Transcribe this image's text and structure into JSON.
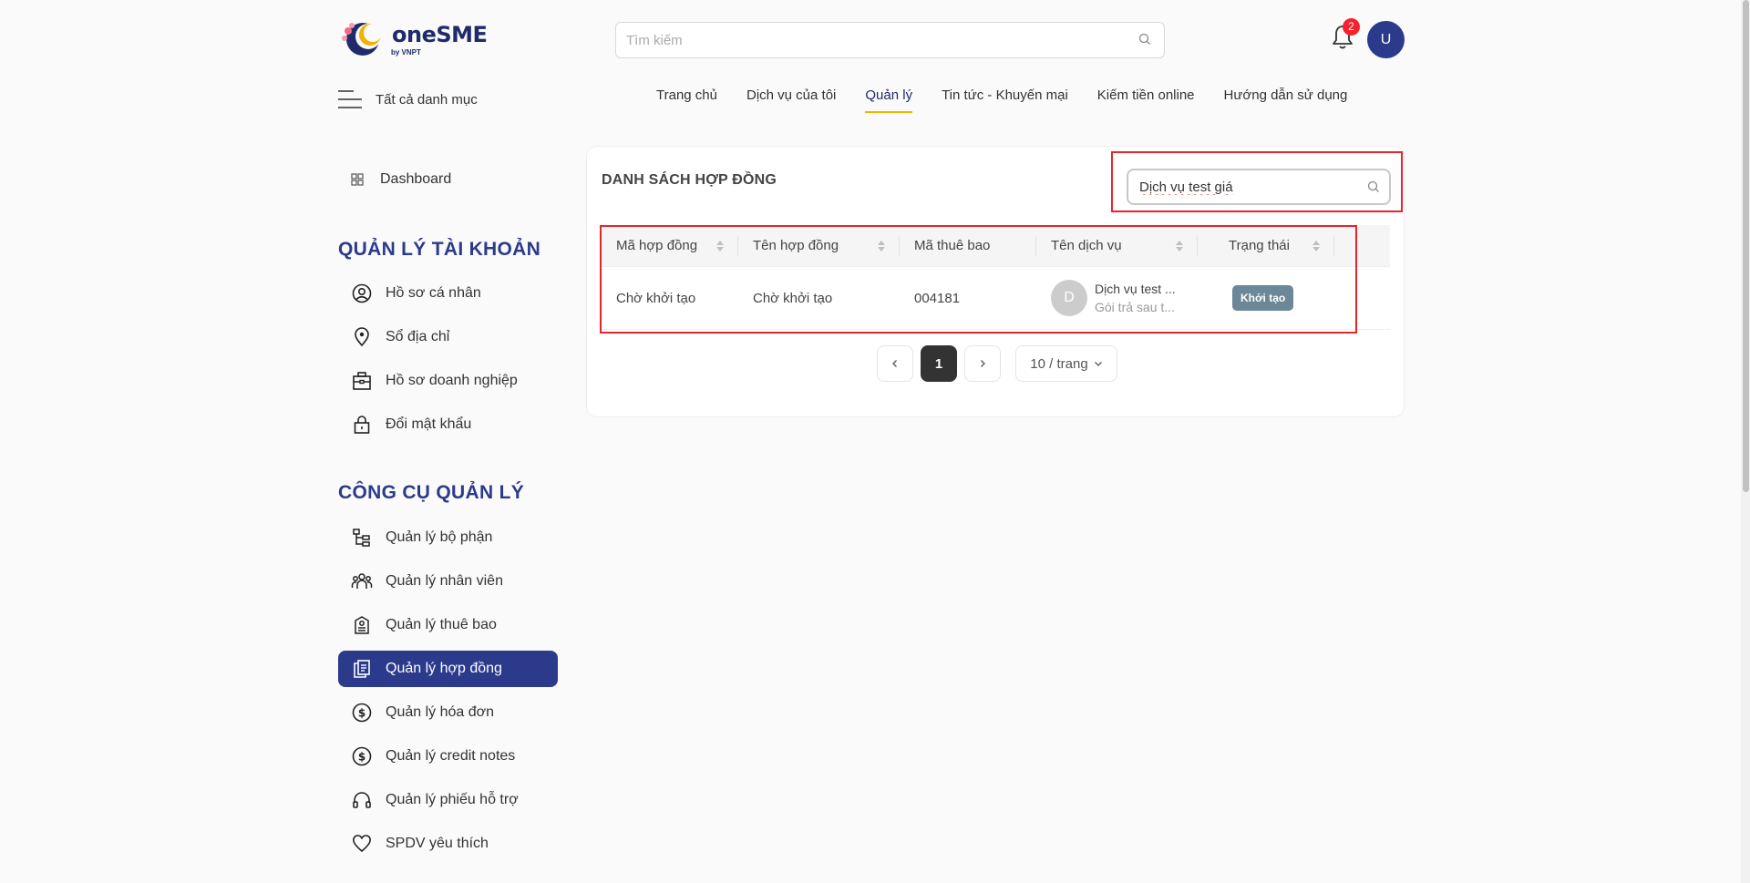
{
  "header": {
    "logo": {
      "brand_one": "one",
      "brand_sme": "SME",
      "by": "by VNPT"
    },
    "search_placeholder": "Tìm kiếm",
    "notifications_count": "2",
    "avatar_initial": "U",
    "menu_label": "Tất cả danh mục",
    "nav": [
      {
        "label": "Trang chủ"
      },
      {
        "label": "Dịch vụ của tôi"
      },
      {
        "label": "Quản lý"
      },
      {
        "label": "Tin tức - Khuyến mại"
      },
      {
        "label": "Kiếm tiền online"
      },
      {
        "label": "Hướng dẫn sử dụng"
      }
    ],
    "active_nav": "Quản lý",
    "active_nav_underline_color": "#f2b200"
  },
  "sidebar": {
    "dashboard": "Dashboard",
    "section_account": "QUẢN LÝ TÀI KHOẢN",
    "account_items": [
      {
        "label": "Hồ sơ cá nhân",
        "icon": "user-circle-icon"
      },
      {
        "label": "Sổ địa chỉ",
        "icon": "location-pin-icon"
      },
      {
        "label": "Hồ sơ doanh nghiệp",
        "icon": "briefcase-icon"
      },
      {
        "label": "Đổi mật khẩu",
        "icon": "lock-icon"
      }
    ],
    "section_tools": "CÔNG CỤ QUẢN LÝ",
    "tool_items": [
      {
        "label": "Quản lý bộ phận",
        "icon": "hierarchy-icon"
      },
      {
        "label": "Quản lý nhân viên",
        "icon": "people-icon"
      },
      {
        "label": "Quản lý thuê bao",
        "icon": "subscription-icon"
      },
      {
        "label": "Quản lý hợp đồng",
        "icon": "documents-icon",
        "active": true
      },
      {
        "label": "Quản lý hóa đơn",
        "icon": "dollar-circle-icon"
      },
      {
        "label": "Quản lý credit notes",
        "icon": "dollar-circle-icon"
      },
      {
        "label": "Quản lý phiếu hỗ trợ",
        "icon": "headset-icon"
      },
      {
        "label": "SPDV yêu thích",
        "icon": "heart-icon"
      }
    ],
    "active_color": "#2c3a8c"
  },
  "contracts": {
    "title": "DANH SÁCH HỢP ĐỒNG",
    "search_value": "Dịch vụ test giá",
    "columns": [
      "Mã hợp đồng",
      "Tên hợp đồng",
      "Mã thuê bao",
      "Tên dịch vụ",
      "Trạng thái"
    ],
    "rows": [
      {
        "contract_code": "Chờ khởi tạo",
        "contract_name": "Chờ khởi tạo",
        "subscription_code": "004181",
        "service_initial": "D",
        "service_name": "Dịch vụ test ...",
        "service_plan": "Gói trả sau t...",
        "status": "Khởi tạo"
      }
    ],
    "pagination": {
      "current_page": "1",
      "page_size": "10 / trang"
    },
    "highlight_color": "#e5252a"
  }
}
